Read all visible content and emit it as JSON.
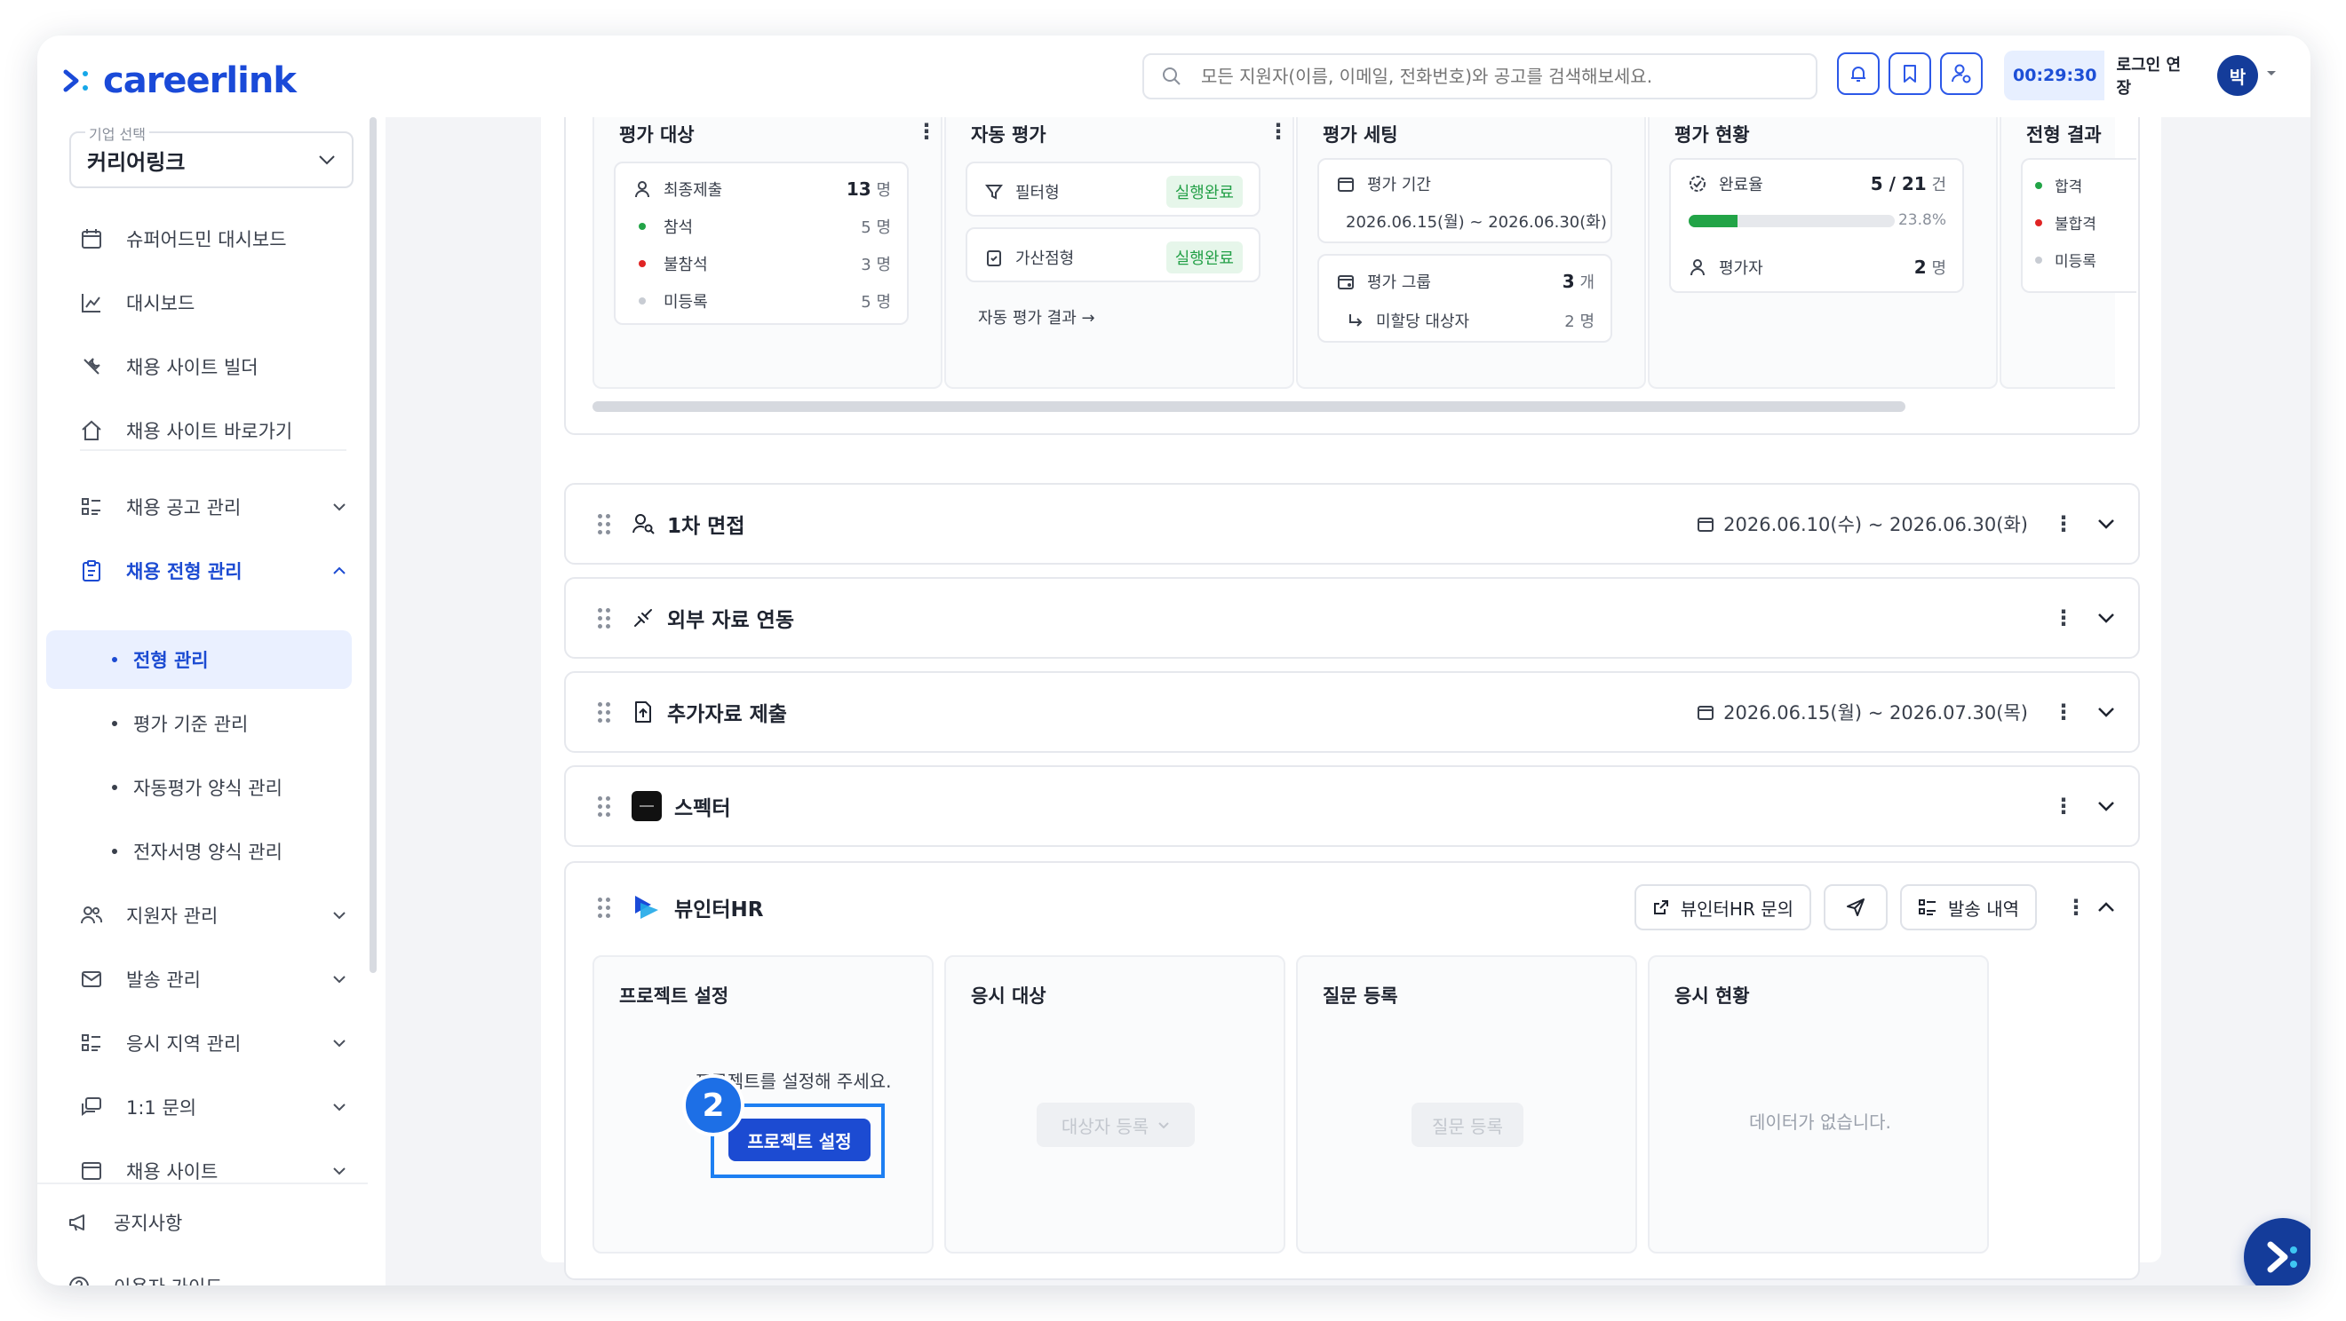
{
  "brand": {
    "logo_text": "careerlink",
    "color": "#1a4ad8"
  },
  "header": {
    "search_placeholder": "모든 지원자(이름, 이메일, 전화번호)와 공고를 검색해보세요.",
    "session_time": "00:29:30",
    "extend_label": "로그인 연장",
    "avatar_initial": "박"
  },
  "sidebar": {
    "company_label": "기업 선택",
    "company_value": "커리어링크",
    "items": [
      {
        "label": "슈퍼어드민 대시보드",
        "icon": "calendar-icon"
      },
      {
        "label": "대시보드",
        "icon": "chart-icon"
      },
      {
        "label": "채용 사이트 빌더",
        "icon": "tools-icon"
      },
      {
        "label": "채용 사이트 바로가기",
        "icon": "home-icon"
      },
      {
        "label": "채용 공고 관리",
        "icon": "list-icon"
      },
      {
        "label": "채용 전형 관리",
        "icon": "clipboard-icon"
      },
      {
        "label": "지원자 관리",
        "icon": "users-icon"
      },
      {
        "label": "발송 관리",
        "icon": "mail-icon"
      },
      {
        "label": "응시 지역 관리",
        "icon": "list-icon"
      },
      {
        "label": "1:1 문의",
        "icon": "chat-icon"
      },
      {
        "label": "채용 사이트",
        "icon": "window-icon"
      },
      {
        "label": "공지사항",
        "icon": "megaphone-icon"
      },
      {
        "label": "이용자 가이드",
        "icon": "help-icon"
      }
    ],
    "subitems": [
      "전형 관리",
      "평가 기준 관리",
      "자동평가 양식 관리",
      "전자서명 양식 관리"
    ]
  },
  "top_card": {
    "col1": {
      "title": "평가 대상",
      "rows": [
        {
          "label": "최종제출",
          "value": "13",
          "unit": "명"
        },
        {
          "label": "참석",
          "value": "5",
          "unit": "명",
          "color": "#22a447"
        },
        {
          "label": "불참석",
          "value": "3",
          "unit": "명",
          "color": "#e02424"
        },
        {
          "label": "미등록",
          "value": "5",
          "unit": "명",
          "color": "#c8ccd3"
        }
      ]
    },
    "col2": {
      "title": "자동 평가",
      "rows": [
        {
          "label": "필터형",
          "status": "실행완료"
        },
        {
          "label": "가산점형",
          "status": "실행완료"
        }
      ],
      "link": "자동 평가 결과 →"
    },
    "col3": {
      "title": "평가 세팅",
      "period_label": "평가 기간",
      "period_value": "2026.06.15(월) ~ 2026.06.30(화)",
      "group_label": "평가 그룹",
      "group_value": "3",
      "group_unit": "개",
      "unassigned_label": "미할당 대상자",
      "unassigned_value": "2",
      "unassigned_unit": "명"
    },
    "col4": {
      "title": "평가 현황",
      "rate_label": "완료율",
      "rate_value": "5 / 21",
      "rate_unit": "건",
      "rate_percent": "23.8%",
      "rate_fraction": 0.238,
      "evaluator_label": "평가자",
      "evaluator_value": "2",
      "evaluator_unit": "명"
    },
    "col5": {
      "title": "전형 결과",
      "rows": [
        {
          "label": "합격",
          "color": "#22a447"
        },
        {
          "label": "불합격",
          "color": "#e02424"
        },
        {
          "label": "미등록",
          "color": "#c8ccd3"
        }
      ]
    }
  },
  "sections": [
    {
      "title": "1차 면접",
      "date": "2026.06.10(수) ~ 2026.06.30(화)"
    },
    {
      "title": "외부 자료 연동",
      "date": ""
    },
    {
      "title": "추가자료 제출",
      "date": "2026.06.15(월) ~ 2026.07.30(목)"
    },
    {
      "title": "스펙터",
      "date": ""
    }
  ],
  "vb": {
    "title": "뷰인터HR",
    "inquiry_label": "뷰인터HR 문의",
    "history_label": "발송 내역",
    "cols": [
      {
        "title": "프로젝트 설정",
        "hint": "프로젝트를 설정해 주세요.",
        "button": "프로젝트 설정"
      },
      {
        "title": "응시 대상",
        "button": "대상자 등록"
      },
      {
        "title": "질문 등록",
        "button": "질문 등록"
      },
      {
        "title": "응시 현황",
        "empty": "데이터가 없습니다."
      }
    ]
  },
  "step_badge": "2"
}
